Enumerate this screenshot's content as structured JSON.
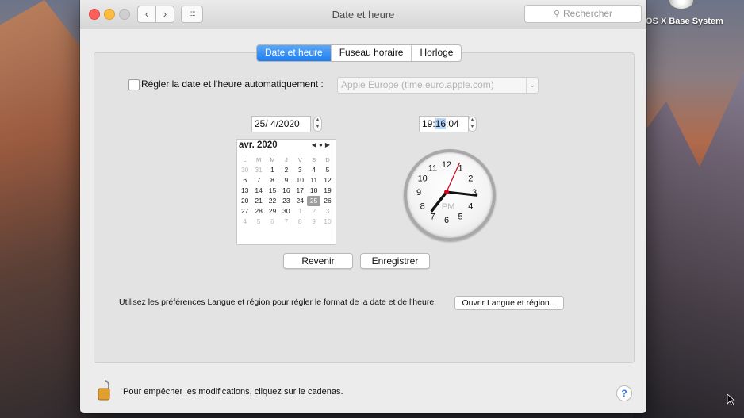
{
  "desktop": {
    "volume_label": "OS X Base System"
  },
  "window": {
    "title": "Date et heure",
    "search_placeholder": "Rechercher",
    "tabs": [
      {
        "label": "Date et heure",
        "active": true
      },
      {
        "label": "Fuseau horaire",
        "active": false
      },
      {
        "label": "Horloge",
        "active": false
      }
    ],
    "auto_set": {
      "label": "Régler la date et l'heure automatiquement :",
      "checked": false,
      "server": "Apple Europe (time.euro.apple.com)"
    },
    "date_field": "25/ 4/2020",
    "time_field": {
      "hours": "19:",
      "minutes": "16",
      "seconds": ":04"
    },
    "calendar": {
      "month_label": "avr. 2020",
      "weekdays": [
        "L",
        "M",
        "M",
        "J",
        "V",
        "S",
        "D"
      ],
      "weeks": [
        [
          {
            "d": "30",
            "dim": true
          },
          {
            "d": "31",
            "dim": true
          },
          {
            "d": "1"
          },
          {
            "d": "2"
          },
          {
            "d": "3"
          },
          {
            "d": "4"
          },
          {
            "d": "5"
          }
        ],
        [
          {
            "d": "6"
          },
          {
            "d": "7"
          },
          {
            "d": "8"
          },
          {
            "d": "9"
          },
          {
            "d": "10"
          },
          {
            "d": "11"
          },
          {
            "d": "12"
          }
        ],
        [
          {
            "d": "13"
          },
          {
            "d": "14"
          },
          {
            "d": "15"
          },
          {
            "d": "16"
          },
          {
            "d": "17"
          },
          {
            "d": "18"
          },
          {
            "d": "19"
          }
        ],
        [
          {
            "d": "20"
          },
          {
            "d": "21"
          },
          {
            "d": "22"
          },
          {
            "d": "23"
          },
          {
            "d": "24"
          },
          {
            "d": "25",
            "selected": true
          },
          {
            "d": "26"
          }
        ],
        [
          {
            "d": "27"
          },
          {
            "d": "28"
          },
          {
            "d": "29"
          },
          {
            "d": "30"
          },
          {
            "d": "1",
            "dim": true
          },
          {
            "d": "2",
            "dim": true
          },
          {
            "d": "3",
            "dim": true
          }
        ],
        [
          {
            "d": "4",
            "dim": true
          },
          {
            "d": "5",
            "dim": true
          },
          {
            "d": "6",
            "dim": true
          },
          {
            "d": "7",
            "dim": true
          },
          {
            "d": "8",
            "dim": true
          },
          {
            "d": "9",
            "dim": true
          },
          {
            "d": "10",
            "dim": true
          }
        ]
      ]
    },
    "clock": {
      "numerals": [
        "12",
        "1",
        "2",
        "3",
        "4",
        "5",
        "6",
        "7",
        "8",
        "9",
        "10",
        "11"
      ],
      "meridiem": "PM",
      "time": {
        "hour": 19,
        "minute": 16,
        "second": 4
      }
    },
    "buttons": {
      "revert": "Revenir",
      "save": "Enregistrer",
      "open_language": "Ouvrir Langue et région..."
    },
    "info_text": "Utilisez les préférences Langue et région pour régler le format de la date et de l'heure.",
    "lock_text": "Pour empêcher les modifications, cliquez sur le cadenas.",
    "help_label": "?"
  }
}
